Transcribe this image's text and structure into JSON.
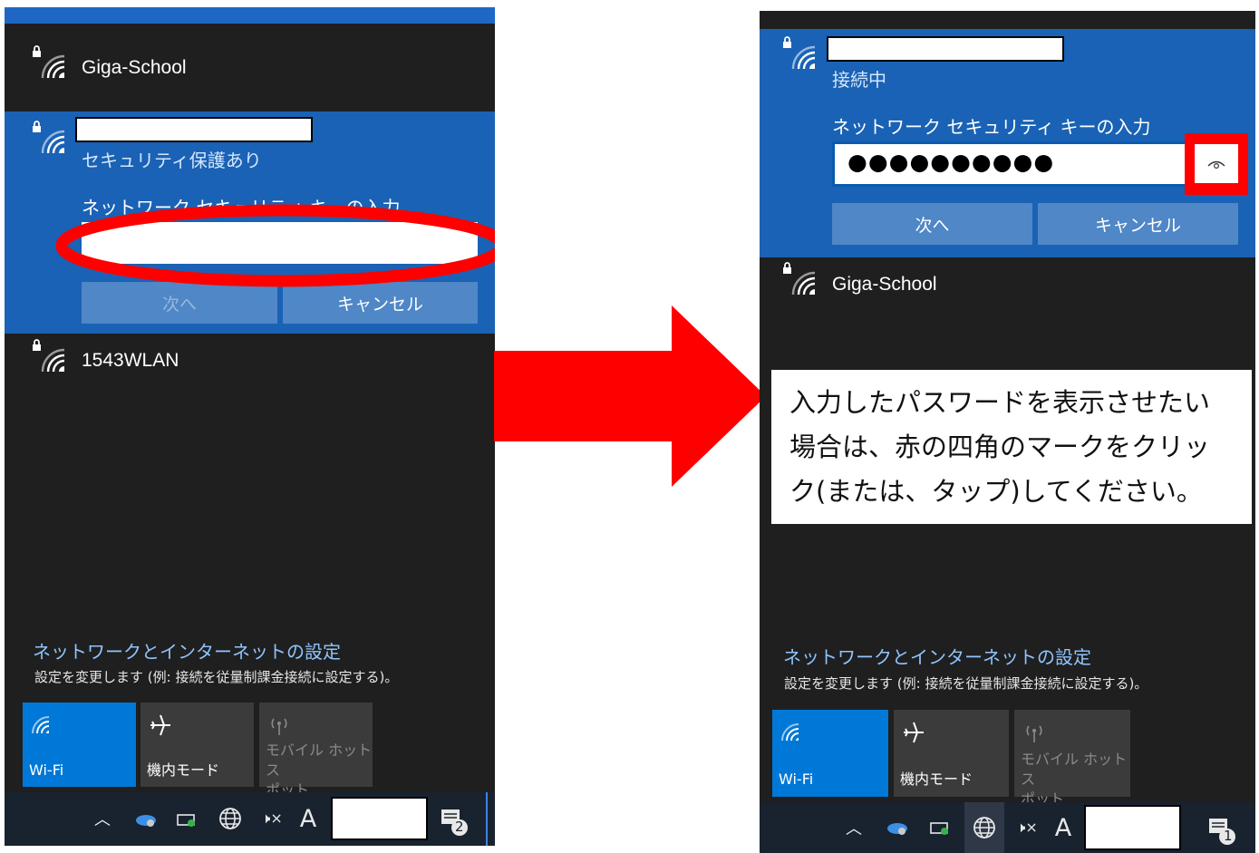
{
  "left_panel": {
    "networks": [
      {
        "name": "Giga-School"
      },
      {
        "name": "",
        "status": "セキュリティ保護あり",
        "key_prompt": "ネットワーク セキュリティ キーの入力"
      },
      {
        "name": "1543WLAN"
      }
    ],
    "password_value": "",
    "next_label": "次へ",
    "cancel_label": "キャンセル",
    "settings_title": "ネットワークとインターネットの設定",
    "settings_desc": "設定を変更します (例: 接続を従量制課金接続に設定する)。",
    "tiles": [
      {
        "label": "Wi-Fi",
        "icon": "wifi-icon"
      },
      {
        "label": "機内モード",
        "icon": "airplane-icon"
      },
      {
        "label": "モバイル ホットス\nポット",
        "icon": "hotspot-icon"
      }
    ],
    "notification_count": "2"
  },
  "right_panel": {
    "connecting_network": {
      "name": "",
      "status": "接続中",
      "key_prompt": "ネットワーク セキュリティ キーの入力"
    },
    "password_masked": "●●●●●●●●●●",
    "next_label": "次へ",
    "cancel_label": "キャンセル",
    "networks": [
      {
        "name": "Giga-School"
      }
    ],
    "settings_title": "ネットワークとインターネットの設定",
    "settings_desc": "設定を変更します (例: 接続を従量制課金接続に設定する)。",
    "tiles": [
      {
        "label": "Wi-Fi",
        "icon": "wifi-icon"
      },
      {
        "label": "機内モード",
        "icon": "airplane-icon"
      },
      {
        "label": "モバイル ホットス\nポット",
        "icon": "hotspot-icon"
      }
    ],
    "notification_count": "1"
  },
  "taskbar": {
    "chevron": "︿",
    "ime_label": "A",
    "mute_glyph": "🕨×"
  },
  "callout": {
    "lines": [
      "入力したパスワードを表示させたい",
      "場合は、赤の四角のマークをクリッ",
      "ク(または、タップ)してください。"
    ]
  },
  "colors": {
    "flyout_bg": "#1f1f1f",
    "selected_network_bg": "#1a62b5",
    "accent_blue": "#0078d7",
    "highlight_red": "#ff0000",
    "settings_link": "#8fc4ff"
  }
}
